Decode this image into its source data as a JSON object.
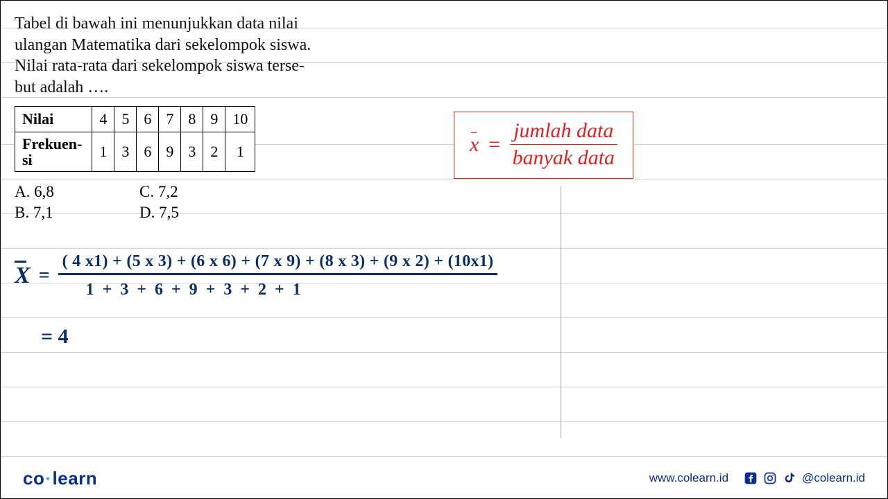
{
  "question": {
    "line1": "Tabel di bawah ini menunjukkan data nilai",
    "line2": "ulangan Matematika dari sekelompok siswa.",
    "line3": "Nilai rata-rata dari sekelompok siswa terse-",
    "line4": "but adalah …."
  },
  "table": {
    "row1_label": "Nilai",
    "row2_label_a": "Frekuen-",
    "row2_label_b": "si",
    "nilai": [
      "4",
      "5",
      "6",
      "7",
      "8",
      "9",
      "10"
    ],
    "frekuensi": [
      "1",
      "3",
      "6",
      "9",
      "3",
      "2",
      "1"
    ]
  },
  "options": {
    "a": "A.  6,8",
    "b": "B.  7,1",
    "c": "C.  7,2",
    "d": "D.  7,5"
  },
  "formula": {
    "lhs_var": "x",
    "eq": "=",
    "numerator": "jumlah data",
    "denominator": "banyak data"
  },
  "work": {
    "lhs": "X",
    "eq": "=",
    "numerator": "( 4 x1) + (5 x 3) + (6 x 6) + (7 x 9) + (8 x 3) + (9 x 2) + (10x1)",
    "denominator": "1 + 3 + 6 + 9 + 3 + 2 + 1",
    "result": "=  4"
  },
  "footer": {
    "logo_a": "co",
    "logo_b": "learn",
    "url": "www.colearn.id",
    "handle": "@colearn.id"
  },
  "chart_data": {
    "type": "table",
    "title": "Nilai ulangan Matematika",
    "columns": [
      "Nilai",
      "Frekuensi"
    ],
    "rows": [
      [
        4,
        1
      ],
      [
        5,
        3
      ],
      [
        6,
        6
      ],
      [
        7,
        9
      ],
      [
        8,
        3
      ],
      [
        9,
        2
      ],
      [
        10,
        1
      ]
    ]
  }
}
